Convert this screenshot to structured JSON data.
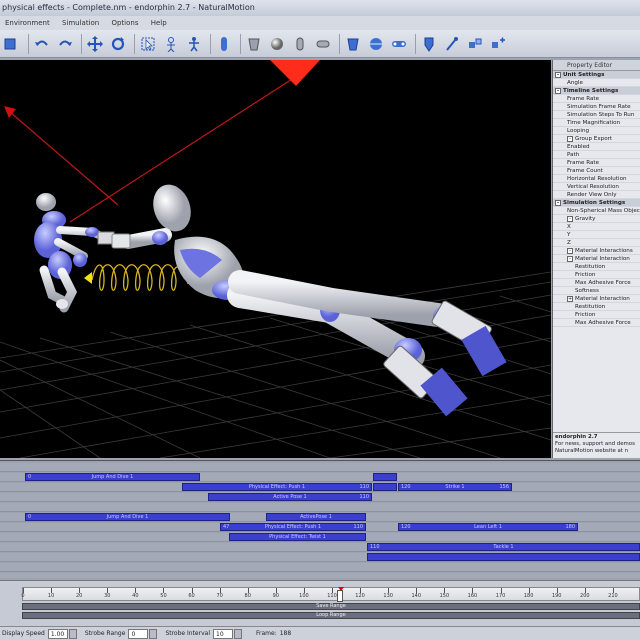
{
  "window": {
    "title": "physical effects - Complete.nm - endorphin 2.7 - NaturalMotion"
  },
  "menu": [
    "Environment",
    "Simulation",
    "Options",
    "Help"
  ],
  "toolbar": {
    "icons": [
      "cursor-icon",
      "undo-icon",
      "redo-icon",
      "move-icon",
      "rotate-icon",
      "select-icon",
      "select-alt-icon",
      "character-icon",
      "body-icon",
      "capsule-icon",
      "sphere-icon",
      "cylinder-icon",
      "capsule-flat-icon",
      "box-icon",
      "disc-icon",
      "link-icon",
      "shield-icon",
      "wrench-icon",
      "effect-icon",
      "constraint-icon"
    ],
    "accent": "#3d6fd0"
  },
  "properties": {
    "title": "Property Editor",
    "rows": [
      {
        "label": "Unit Settings",
        "section": true
      },
      {
        "label": "Angle"
      },
      {
        "label": "Timeline Settings",
        "section": true
      },
      {
        "label": "Frame Rate"
      },
      {
        "label": "Simulation Frame Rate"
      },
      {
        "label": "Simulation Steps To Run"
      },
      {
        "label": "Time Magnification"
      },
      {
        "label": "Looping"
      },
      {
        "label": "Group Export",
        "expander": "-"
      },
      {
        "label": "Enabled",
        "indent": true
      },
      {
        "label": "Path",
        "indent": true
      },
      {
        "label": "Frame Rate",
        "indent": true
      },
      {
        "label": "Frame Count",
        "indent": true
      },
      {
        "label": "Horizontal Resolution",
        "indent": true
      },
      {
        "label": "Vertical Resolution",
        "indent": true
      },
      {
        "label": "Render View Only",
        "indent": true
      },
      {
        "label": "Simulation Settings",
        "section": true
      },
      {
        "label": "Non-Spherical Mass Objects"
      },
      {
        "label": "Gravity",
        "expander": "-"
      },
      {
        "label": "X",
        "indent": true
      },
      {
        "label": "Y",
        "indent": true
      },
      {
        "label": "Z",
        "indent": true
      },
      {
        "label": "Material Interactions",
        "expander": "-"
      },
      {
        "label": "Material Interaction",
        "expander": "-",
        "indent": true
      },
      {
        "label": "Restitution",
        "indent2": true
      },
      {
        "label": "Friction",
        "indent2": true
      },
      {
        "label": "Max Adhesive Force",
        "indent2": true
      },
      {
        "label": "Softness",
        "indent2": true
      },
      {
        "label": "Material Interaction",
        "expander": "+",
        "indent": true
      },
      {
        "label": "Restitution",
        "indent2": true
      },
      {
        "label": "Friction",
        "indent2": true
      },
      {
        "label": "Max Adhesive Force",
        "indent2": true
      }
    ],
    "description_title": "endorphin 2.7",
    "description": "For news, support and demos NaturalMotion website at n"
  },
  "timeline": {
    "clips": [
      {
        "row": 1,
        "label": "Jump And Dive 1",
        "left_num": "0",
        "right_num": "",
        "start": 25,
        "end": 200
      },
      {
        "row": 1,
        "label": "",
        "left_num": "",
        "right_num": "",
        "start": 373,
        "end": 397
      },
      {
        "row": 2,
        "label": "Physical Effect: Push 1",
        "left_num": "",
        "right_num": "110",
        "start": 182,
        "end": 372
      },
      {
        "row": 2,
        "label": "",
        "left_num": "",
        "right_num": "",
        "start": 373,
        "end": 397
      },
      {
        "row": 2,
        "label": "Strike 1",
        "left_num": "120",
        "right_num": "156",
        "start": 398,
        "end": 512
      },
      {
        "row": 3,
        "label": "Active Pose 1",
        "left_num": "",
        "right_num": "110",
        "start": 208,
        "end": 372
      },
      {
        "row": 5,
        "label": "Jump And Dive 1",
        "left_num": "0",
        "right_num": "",
        "start": 25,
        "end": 230
      },
      {
        "row": 5,
        "label": "ActivePose 1",
        "left_num": "",
        "right_num": "",
        "start": 266,
        "end": 366
      },
      {
        "row": 6,
        "label": "Physical Effect: Push 1",
        "left_num": "47",
        "right_num": "110",
        "start": 220,
        "end": 366
      },
      {
        "row": 6,
        "label": "Lean Left 1",
        "left_num": "120",
        "right_num": "180",
        "start": 398,
        "end": 578
      },
      {
        "row": 7,
        "label": "Physical Effect: Twist 1",
        "left_num": "",
        "right_num": "",
        "start": 229,
        "end": 366
      },
      {
        "row": 8,
        "label": "Tackle 1",
        "left_num": "110",
        "right_num": "",
        "start": 367,
        "end": 640
      },
      {
        "row": 9,
        "label": "",
        "left_num": "",
        "right_num": "",
        "start": 367,
        "end": 640
      }
    ]
  },
  "ruler": {
    "ticks": [
      "0",
      "10",
      "20",
      "30",
      "40",
      "50",
      "60",
      "70",
      "80",
      "90",
      "100",
      "110",
      "120",
      "130",
      "140",
      "150",
      "160",
      "170",
      "180",
      "190",
      "200",
      "210"
    ],
    "current_frame": 113,
    "save_range_label": "Save Range",
    "loop_range_label": "Loop Range"
  },
  "status": {
    "display_speed_label": "Display Speed",
    "display_speed": "1.00",
    "strobe_range_label": "Strobe Range",
    "strobe_range": "0",
    "strobe_interval_label": "Strobe Interval",
    "strobe_interval": "10",
    "frame_label": "Frame:",
    "frame": "188"
  }
}
